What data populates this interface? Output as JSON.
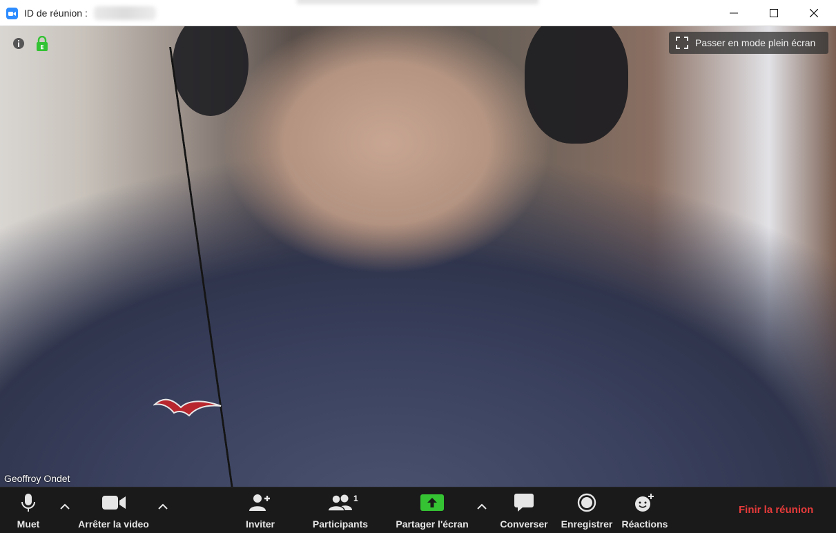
{
  "window": {
    "title_label": "ID de réunion :"
  },
  "overlay": {
    "fullscreen_label": "Passer en mode plein écran",
    "participant_name": "Geoffroy Ondet"
  },
  "toolbar": {
    "mute_label": "Muet",
    "video_label": "Arrêter la video",
    "invite_label": "Inviter",
    "participants_label": "Participants",
    "participants_count": "1",
    "share_label": "Partager l'écran",
    "chat_label": "Converser",
    "record_label": "Enregistrer",
    "reactions_label": "Réactions",
    "end_label": "Finir la réunion"
  },
  "colors": {
    "accent": "#2d8cff",
    "share_green": "#35c334",
    "end_red": "#e83b3b",
    "lock_green": "#33c233",
    "toolbar_bg": "#1a1a1a"
  },
  "icons": [
    "app-icon",
    "info-icon",
    "lock-icon",
    "fullscreen-icon",
    "microphone-icon",
    "video-camera-icon",
    "invite-icon",
    "participants-icon",
    "share-screen-icon",
    "chat-icon",
    "record-icon",
    "reactions-icon",
    "chevron-up-icon",
    "minimize-icon",
    "maximize-icon",
    "close-icon"
  ]
}
